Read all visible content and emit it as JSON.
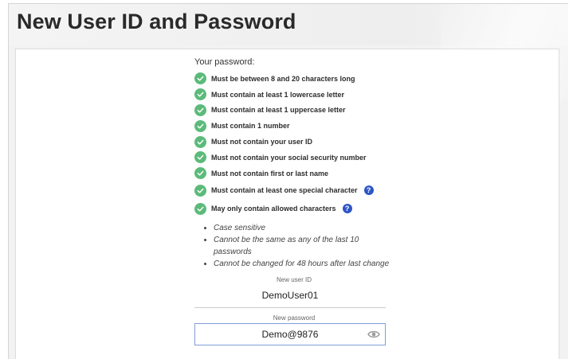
{
  "page": {
    "title": "New User ID and Password"
  },
  "requirements": {
    "intro": "Your password:",
    "rules": [
      {
        "text": "Must be between 8 and 20 characters long",
        "met": true,
        "help": false
      },
      {
        "text": "Must contain at least 1 lowercase letter",
        "met": true,
        "help": false
      },
      {
        "text": "Must contain at least 1 uppercase letter",
        "met": true,
        "help": false
      },
      {
        "text": "Must contain 1 number",
        "met": true,
        "help": false
      },
      {
        "text": "Must not contain your user ID",
        "met": true,
        "help": false
      },
      {
        "text": "Must not contain your social security number",
        "met": true,
        "help": false
      },
      {
        "text": "Must not contain first or last name",
        "met": true,
        "help": false
      },
      {
        "text": "Must contain at least one special character",
        "met": true,
        "help": true
      },
      {
        "text": "May only contain allowed characters",
        "met": true,
        "help": true
      }
    ],
    "help_glyph": "?",
    "notes": [
      "Case sensitive",
      "Cannot be the same as any of the last 10 passwords",
      "Cannot be changed for 48 hours after last change"
    ]
  },
  "form": {
    "user_id_label": "New user ID",
    "user_id_value": "DemoUser01",
    "password_label": "New password",
    "password_value": "Demo@9876"
  },
  "colors": {
    "check": "#5cba7a",
    "help": "#2f56c6",
    "field_border": "#7f9ed8"
  }
}
